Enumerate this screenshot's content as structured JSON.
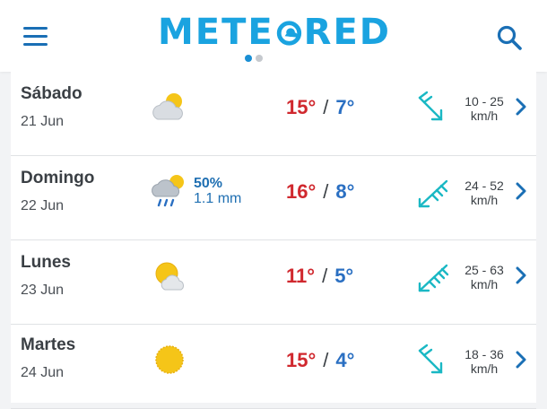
{
  "header": {
    "brand": "METEORED",
    "brand_parts": [
      "METE",
      "RED"
    ],
    "brand_color": "#1aa3e0",
    "menu_icon": "hamburger-icon",
    "search_icon": "search-icon",
    "pager": {
      "pages": 2,
      "active": 1
    }
  },
  "colors": {
    "max_temp": "#d0282e",
    "min_temp": "#2a6fc2",
    "wind": "#1ab8c4",
    "precip": "#1f6fb2",
    "chevron": "#1a6fb5"
  },
  "forecast": [
    {
      "day": "Sábado",
      "date": "21 Jun",
      "icon": "partly-cloudy-icon",
      "precip_pct": "",
      "precip_mm": "",
      "max": "15°",
      "min": "7°",
      "sep": "/",
      "wind_icon": "wind-arrow-icon",
      "wind_range": "10 - 25",
      "wind_unit": "km/h"
    },
    {
      "day": "Domingo",
      "date": "22 Jun",
      "icon": "sun-cloud-rain-icon",
      "precip_pct": "50%",
      "precip_mm": "1.1 mm",
      "max": "16°",
      "min": "8°",
      "sep": "/",
      "wind_icon": "wind-barb-icon",
      "wind_range": "24 - 52",
      "wind_unit": "km/h"
    },
    {
      "day": "Lunes",
      "date": "23 Jun",
      "icon": "sun-behind-cloud-icon",
      "precip_pct": "",
      "precip_mm": "",
      "max": "11°",
      "min": "5°",
      "sep": "/",
      "wind_icon": "wind-barb-icon",
      "wind_range": "25 - 63",
      "wind_unit": "km/h"
    },
    {
      "day": "Martes",
      "date": "24 Jun",
      "icon": "sun-icon",
      "precip_pct": "",
      "precip_mm": "",
      "max": "15°",
      "min": "4°",
      "sep": "/",
      "wind_icon": "wind-arrow-icon",
      "wind_range": "18 - 36",
      "wind_unit": "km/h"
    }
  ]
}
